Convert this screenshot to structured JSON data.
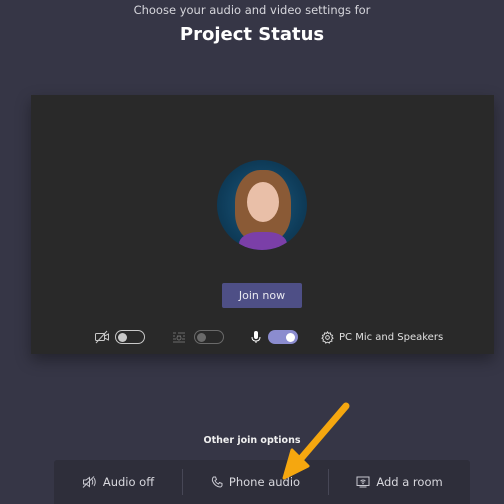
{
  "header": {
    "subtitle": "Choose your audio and video settings for",
    "meeting_title": "Project Status"
  },
  "preview": {
    "join_button_label": "Join now",
    "controls": {
      "camera_toggle": "off",
      "blur_toggle": "disabled",
      "mic_toggle": "on",
      "device_label": "PC Mic and Speakers"
    }
  },
  "other_options": {
    "label": "Other join options",
    "items": [
      {
        "label": "Audio off",
        "icon": "speaker-off-icon"
      },
      {
        "label": "Phone audio",
        "icon": "phone-icon"
      },
      {
        "label": "Add a room",
        "icon": "cast-room-icon"
      }
    ]
  },
  "annotation": {
    "arrow_color": "#f5a70f"
  },
  "colors": {
    "background": "#363646",
    "panel": "#292929",
    "accent": "#4e4f86",
    "toggle_on": "#8b8ccf"
  }
}
